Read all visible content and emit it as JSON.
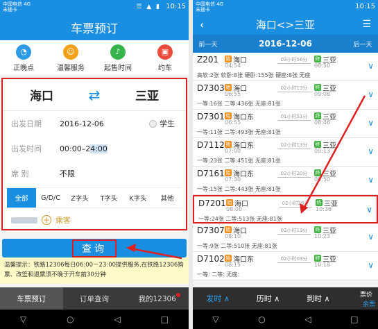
{
  "left": {
    "status": {
      "carrier_line1": "中国电信 4G",
      "carrier_line2": "未插卡",
      "signal": "☰ ▲ ▮",
      "time": "10:15"
    },
    "title": "车票预订",
    "quick": [
      {
        "label": "正晚点",
        "icon": "clock-icon",
        "color": "#2e9be6"
      },
      {
        "label": "温馨服务",
        "icon": "service-icon",
        "color": "#f3a21a"
      },
      {
        "label": "起售时间",
        "icon": "bell-icon",
        "color": "#36b34a"
      },
      {
        "label": "约车",
        "icon": "car-icon",
        "color": "#ec4a3a"
      }
    ],
    "from_station": "海口",
    "to_station": "三亚",
    "date_label": "出发日期",
    "date_value": "2016-12-06",
    "student_label": "学生",
    "time_label": "出发时间",
    "time_value_a": "00:00–2",
    "time_value_b": "4:00",
    "seat_label": "席    别",
    "seat_value": "不限",
    "train_types": [
      "全部",
      "G/D/C",
      "Z字头",
      "T字头",
      "K字头",
      "其他"
    ],
    "passenger_label": "乘客",
    "query_button": "查询",
    "tip_text": "温馨提示：铁路12306每日06:00－23:00提供服务,在铁路12306购票、改签和退票须不晚于开车前30分钟",
    "bottom_nav": [
      "车票预订",
      "订单查询",
      "我的12306"
    ]
  },
  "right": {
    "status": {
      "carrier_line1": "中国电信 4G",
      "carrier_line2": "未插卡",
      "time": "10:15"
    },
    "title": "海口<>三亚",
    "prev_day": "前一天",
    "date": "2016-12-06",
    "next_day": "后一天",
    "trains": [
      {
        "no": "Z201",
        "from": "海口",
        "dep": "04:54",
        "dur": "03小时56分",
        "to": "三亚",
        "arr": "08:50",
        "seats": "高软:2张  软卧:8张  硬卧:155张  硬座:8张  无座",
        "selected": false
      },
      {
        "no": "D7303",
        "from": "海口",
        "dep": "06:55",
        "dur": "02小时13分",
        "to": "三亚",
        "arr": "09:08",
        "seats": "一等:16张  二等:436张  无座:81张",
        "selected": false
      },
      {
        "no": "D7301",
        "from": "海口东",
        "dep": "06:55",
        "dur": "01小时51分",
        "to": "三亚",
        "arr": "08:46",
        "seats": "一等:11张  二等:493张  无座:81张",
        "selected": false
      },
      {
        "no": "D7112",
        "from": "海口东",
        "dep": "07:00",
        "dur": "02小时13分",
        "to": "三亚",
        "arr": "09:13",
        "seats": "一等:23张  二等:451张  无座:81张",
        "selected": false
      },
      {
        "no": "D7161",
        "from": "海口东",
        "dep": "07:30",
        "dur": "02小时20分",
        "to": "三亚",
        "arr": "09:50",
        "seats": "一等:15张  二等:443张  无座:81张",
        "selected": false
      },
      {
        "no": "D7201",
        "from": "海口",
        "dep": "08:00",
        "dur": "02小时36分",
        "to": "三亚",
        "arr": "10:36",
        "seats": "一等:24张  二等:513张  无座:81张",
        "selected": true
      },
      {
        "no": "D7307",
        "from": "海口",
        "dep": "08:10",
        "dur": "02小时13分",
        "to": "三亚",
        "arr": "10:23",
        "seats": "一等:9张  二等:510张  无座:81张",
        "selected": false
      },
      {
        "no": "D7102",
        "from": "海口东",
        "dep": "08:15",
        "dur": "02小时03分",
        "to": "三亚",
        "arr": "10:18",
        "seats": "一等:  二等:  无座:",
        "selected": false
      }
    ],
    "sort": [
      "发时 ∧",
      "历时 ∧",
      "到时 ∧"
    ],
    "price_line1": "票价",
    "price_line2": "余票"
  },
  "sysnav": [
    "▽",
    "○",
    "◁",
    "□"
  ],
  "colors": {
    "accent": "#1a8ee0",
    "highlight": "#e02020"
  }
}
